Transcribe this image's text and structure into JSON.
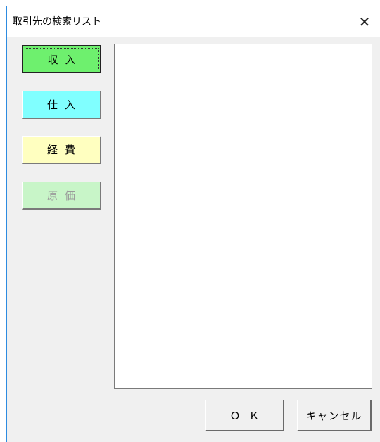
{
  "window": {
    "title": "取引先の検索リスト",
    "close_glyph": "✕"
  },
  "categories": [
    {
      "label": "収入",
      "color": "#6ef06e",
      "enabled": true
    },
    {
      "label": "仕入",
      "color": "#80ffff",
      "enabled": true
    },
    {
      "label": "経費",
      "color": "#ffffc0",
      "enabled": true
    },
    {
      "label": "原価",
      "color": "#c8f5c8",
      "enabled": false
    }
  ],
  "buttons": {
    "ok": "ＯＫ",
    "cancel": "キャンセル"
  }
}
